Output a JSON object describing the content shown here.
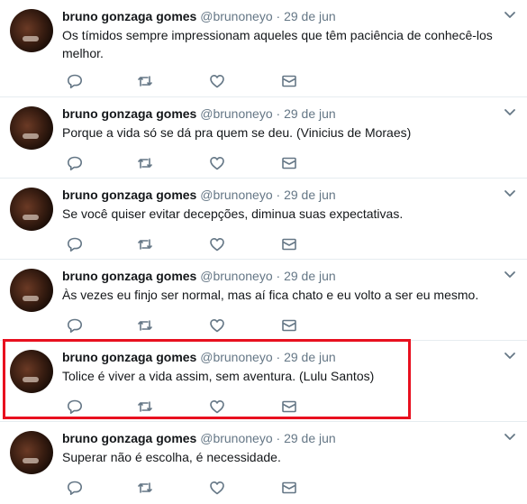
{
  "tweets": [
    {
      "name": "bruno gonzaga gomes",
      "handle": "@brunoneyo",
      "separator": "·",
      "time": "29 de jun",
      "text": "Os tímidos sempre impressionam aqueles que têm paciência de conhecê-los melhor."
    },
    {
      "name": "bruno gonzaga gomes",
      "handle": "@brunoneyo",
      "separator": "·",
      "time": "29 de jun",
      "text": "Porque a vida só se dá pra quem se deu. (Vinicius de Moraes)"
    },
    {
      "name": "bruno gonzaga gomes",
      "handle": "@brunoneyo",
      "separator": "·",
      "time": "29 de jun",
      "text": "Se você quiser evitar decepções, diminua suas expectativas."
    },
    {
      "name": "bruno gonzaga gomes",
      "handle": "@brunoneyo",
      "separator": "·",
      "time": "29 de jun",
      "text": "Às vezes eu finjo ser normal, mas aí fica chato e eu volto a ser eu mesmo."
    },
    {
      "name": "bruno gonzaga gomes",
      "handle": "@brunoneyo",
      "separator": "·",
      "time": "29 de jun",
      "text": "Tolice é viver a vida assim, sem aventura. (Lulu Santos)"
    },
    {
      "name": "bruno gonzaga gomes",
      "handle": "@brunoneyo",
      "separator": "·",
      "time": "29 de jun",
      "text": "Superar não é escolha, é necessidade."
    }
  ],
  "icons": {
    "reply": "reply-icon",
    "retweet": "retweet-icon",
    "like": "heart-icon",
    "message": "envelope-icon",
    "menu": "chevron-down-icon"
  },
  "colors": {
    "icon": "#657786",
    "name": "#14171a",
    "muted": "#657786",
    "divider": "#e6ecf0",
    "highlight": "#e8101f"
  }
}
